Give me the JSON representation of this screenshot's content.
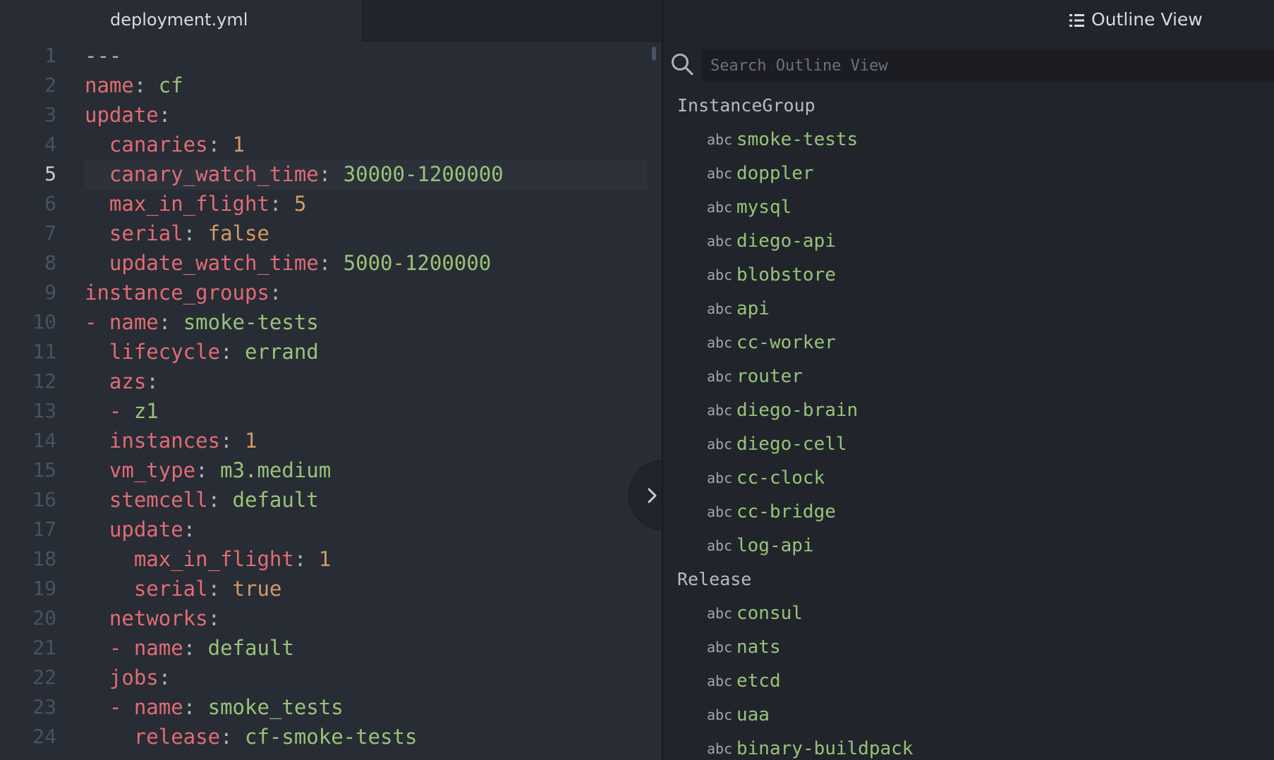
{
  "editor": {
    "tab_title": "deployment.yml",
    "active_line": 5,
    "lines": [
      {
        "num": "1",
        "tokens": [
          {
            "t": "---",
            "c": "c"
          }
        ]
      },
      {
        "num": "2",
        "tokens": [
          {
            "t": "name",
            "c": "k"
          },
          {
            "t": ": ",
            "c": "p"
          },
          {
            "t": "cf",
            "c": "s"
          }
        ]
      },
      {
        "num": "3",
        "tokens": [
          {
            "t": "update",
            "c": "k"
          },
          {
            "t": ":",
            "c": "p"
          }
        ]
      },
      {
        "num": "4",
        "tokens": [
          {
            "t": "  ",
            "c": "p"
          },
          {
            "t": "canaries",
            "c": "k"
          },
          {
            "t": ": ",
            "c": "p"
          },
          {
            "t": "1",
            "c": "n"
          }
        ]
      },
      {
        "num": "5",
        "tokens": [
          {
            "t": "  ",
            "c": "p"
          },
          {
            "t": "canary_watch_time",
            "c": "k"
          },
          {
            "t": ": ",
            "c": "p"
          },
          {
            "t": "30000-1200000",
            "c": "s"
          }
        ]
      },
      {
        "num": "6",
        "tokens": [
          {
            "t": "  ",
            "c": "p"
          },
          {
            "t": "max_in_flight",
            "c": "k"
          },
          {
            "t": ": ",
            "c": "p"
          },
          {
            "t": "5",
            "c": "n"
          }
        ]
      },
      {
        "num": "7",
        "tokens": [
          {
            "t": "  ",
            "c": "p"
          },
          {
            "t": "serial",
            "c": "k"
          },
          {
            "t": ": ",
            "c": "p"
          },
          {
            "t": "false",
            "c": "n"
          }
        ]
      },
      {
        "num": "8",
        "tokens": [
          {
            "t": "  ",
            "c": "p"
          },
          {
            "t": "update_watch_time",
            "c": "k"
          },
          {
            "t": ": ",
            "c": "p"
          },
          {
            "t": "5000-1200000",
            "c": "s"
          }
        ]
      },
      {
        "num": "9",
        "tokens": [
          {
            "t": "instance_groups",
            "c": "k"
          },
          {
            "t": ":",
            "c": "p"
          }
        ]
      },
      {
        "num": "10",
        "tokens": [
          {
            "t": "- ",
            "c": "k"
          },
          {
            "t": "name",
            "c": "k"
          },
          {
            "t": ": ",
            "c": "p"
          },
          {
            "t": "smoke-tests",
            "c": "s"
          }
        ]
      },
      {
        "num": "11",
        "tokens": [
          {
            "t": "  ",
            "c": "p"
          },
          {
            "t": "lifecycle",
            "c": "k"
          },
          {
            "t": ": ",
            "c": "p"
          },
          {
            "t": "errand",
            "c": "s"
          }
        ]
      },
      {
        "num": "12",
        "tokens": [
          {
            "t": "  ",
            "c": "p"
          },
          {
            "t": "azs",
            "c": "k"
          },
          {
            "t": ":",
            "c": "p"
          }
        ]
      },
      {
        "num": "13",
        "tokens": [
          {
            "t": "  ",
            "c": "p"
          },
          {
            "t": "- ",
            "c": "k"
          },
          {
            "t": "z1",
            "c": "s"
          }
        ]
      },
      {
        "num": "14",
        "tokens": [
          {
            "t": "  ",
            "c": "p"
          },
          {
            "t": "instances",
            "c": "k"
          },
          {
            "t": ": ",
            "c": "p"
          },
          {
            "t": "1",
            "c": "n"
          }
        ]
      },
      {
        "num": "15",
        "tokens": [
          {
            "t": "  ",
            "c": "p"
          },
          {
            "t": "vm_type",
            "c": "k"
          },
          {
            "t": ": ",
            "c": "p"
          },
          {
            "t": "m3.medium",
            "c": "s"
          }
        ]
      },
      {
        "num": "16",
        "tokens": [
          {
            "t": "  ",
            "c": "p"
          },
          {
            "t": "stemcell",
            "c": "k"
          },
          {
            "t": ": ",
            "c": "p"
          },
          {
            "t": "default",
            "c": "s"
          }
        ]
      },
      {
        "num": "17",
        "tokens": [
          {
            "t": "  ",
            "c": "p"
          },
          {
            "t": "update",
            "c": "k"
          },
          {
            "t": ":",
            "c": "p"
          }
        ]
      },
      {
        "num": "18",
        "tokens": [
          {
            "t": "    ",
            "c": "p"
          },
          {
            "t": "max_in_flight",
            "c": "k"
          },
          {
            "t": ": ",
            "c": "p"
          },
          {
            "t": "1",
            "c": "n"
          }
        ]
      },
      {
        "num": "19",
        "tokens": [
          {
            "t": "    ",
            "c": "p"
          },
          {
            "t": "serial",
            "c": "k"
          },
          {
            "t": ": ",
            "c": "p"
          },
          {
            "t": "true",
            "c": "n"
          }
        ]
      },
      {
        "num": "20",
        "tokens": [
          {
            "t": "  ",
            "c": "p"
          },
          {
            "t": "networks",
            "c": "k"
          },
          {
            "t": ":",
            "c": "p"
          }
        ]
      },
      {
        "num": "21",
        "tokens": [
          {
            "t": "  ",
            "c": "p"
          },
          {
            "t": "- ",
            "c": "k"
          },
          {
            "t": "name",
            "c": "k"
          },
          {
            "t": ": ",
            "c": "p"
          },
          {
            "t": "default",
            "c": "s"
          }
        ]
      },
      {
        "num": "22",
        "tokens": [
          {
            "t": "  ",
            "c": "p"
          },
          {
            "t": "jobs",
            "c": "k"
          },
          {
            "t": ":",
            "c": "p"
          }
        ]
      },
      {
        "num": "23",
        "tokens": [
          {
            "t": "  ",
            "c": "p"
          },
          {
            "t": "- ",
            "c": "k"
          },
          {
            "t": "name",
            "c": "k"
          },
          {
            "t": ": ",
            "c": "p"
          },
          {
            "t": "smoke_tests",
            "c": "s"
          }
        ]
      },
      {
        "num": "24",
        "tokens": [
          {
            "t": "    ",
            "c": "p"
          },
          {
            "t": "release",
            "c": "k"
          },
          {
            "t": ": ",
            "c": "p"
          },
          {
            "t": "cf-smoke-tests",
            "c": "s"
          }
        ]
      }
    ]
  },
  "outline": {
    "title": "Outline View",
    "icon": "list-icon",
    "search_placeholder": "Search Outline View",
    "search_icon": "search-icon",
    "groups": [
      {
        "label": "InstanceGroup",
        "items": [
          "smoke-tests",
          "doppler",
          "mysql",
          "diego-api",
          "blobstore",
          "api",
          "cc-worker",
          "router",
          "diego-brain",
          "diego-cell",
          "cc-clock",
          "cc-bridge",
          "log-api"
        ]
      },
      {
        "label": "Release",
        "items": [
          "consul",
          "nats",
          "etcd",
          "uaa",
          "binary-buildpack"
        ]
      }
    ],
    "item_type_label": "abc"
  },
  "colors": {
    "background": "#282c34",
    "panel": "#21252b",
    "key": "#e06c75",
    "string": "#98c379",
    "number": "#d19a66",
    "line_number": "#495162"
  }
}
